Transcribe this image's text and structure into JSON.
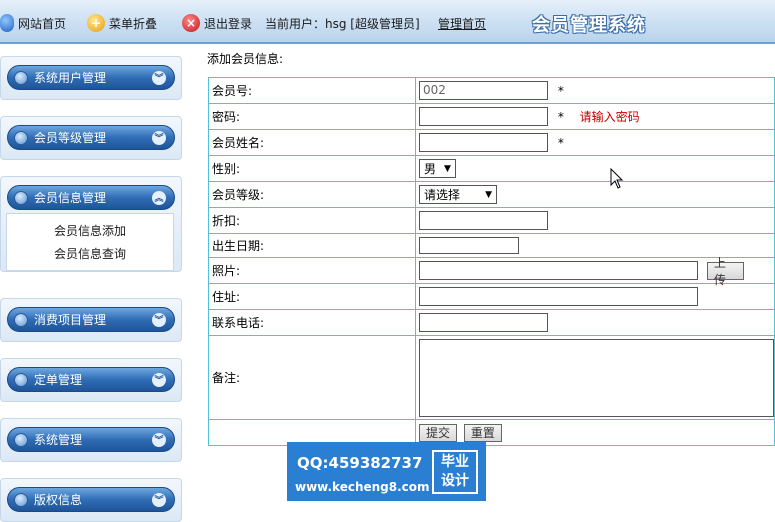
{
  "topbar": {
    "home_label": "网站首页",
    "fold_label": "菜单折叠",
    "logout_label": "退出登录",
    "current_user": "当前用户：hsg [超级管理员]",
    "admin_home_label": "管理首页",
    "system_title": "会员管理系统"
  },
  "sidebar": {
    "items": [
      {
        "label": "系统用户管理",
        "icon": "chevron-down-icon"
      },
      {
        "label": "会员等级管理",
        "icon": "chevron-down-icon"
      },
      {
        "label": "会员信息管理",
        "icon": "chevron-up-icon"
      },
      {
        "label": "消费项目管理",
        "icon": "chevron-down-icon"
      },
      {
        "label": "定单管理",
        "icon": "chevron-down-icon"
      },
      {
        "label": "系统管理",
        "icon": "chevron-down-icon"
      },
      {
        "label": "版权信息",
        "icon": "chevron-down-icon"
      }
    ],
    "submenu": [
      "会员信息添加",
      "会员信息查询"
    ]
  },
  "form": {
    "title": "添加会员信息:",
    "member_no_label": "会员号:",
    "member_no_value": "002",
    "password_label": "密码:",
    "password_error": "请输入密码",
    "name_label": "会员姓名:",
    "gender_label": "性别:",
    "gender_value": "男",
    "level_label": "会员等级:",
    "level_value": "请选择",
    "discount_label": "折扣:",
    "birthday_label": "出生日期:",
    "photo_label": "照片:",
    "upload_label": "上传",
    "address_label": "住址:",
    "phone_label": "联系电话:",
    "remark_label": "备注:",
    "required_mark": "*",
    "submit_label": "提交",
    "reset_label": "重置"
  },
  "watermark": {
    "qq": "QQ:459382737",
    "url": "www.kecheng8.com",
    "badge_line1": "毕业",
    "badge_line2": "设计"
  }
}
